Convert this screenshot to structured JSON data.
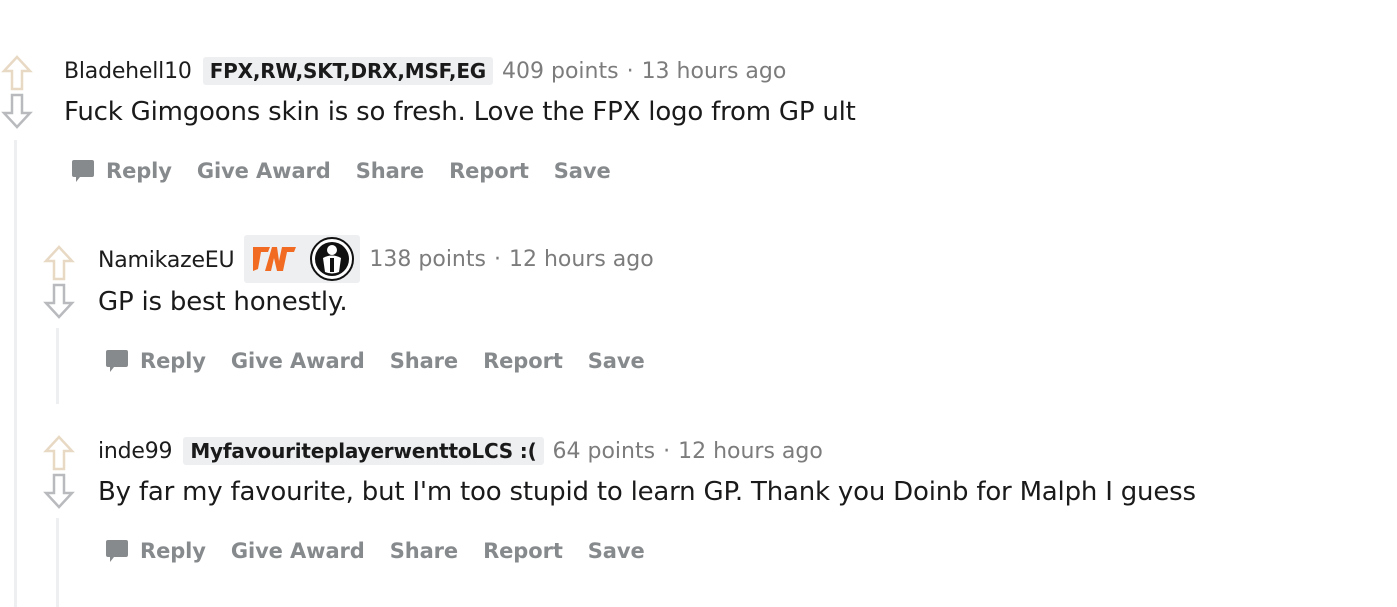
{
  "colors": {
    "upvote_arrow": "#e8d9c4",
    "downvote_arrow": "#b8babd",
    "thread_line": "#edeff1",
    "flair_bg": "#edeff1",
    "action_text": "#878a8c",
    "fnatic_orange": "#f26b22"
  },
  "actions": {
    "reply": "Reply",
    "give_award": "Give Award",
    "share": "Share",
    "report": "Report",
    "save": "Save"
  },
  "comments": [
    {
      "author": "Bladehell10",
      "flair": "FPX,RW,SKT,DRX,MSF,EG",
      "points": "409 points",
      "separator": "·",
      "time": "13 hours ago",
      "body": "Fuck Gimgoons skin is so fresh. Love the FPX logo from GP ult"
    },
    {
      "author": "NamikazeEU",
      "flair_icons": [
        "fnatic-logo-icon",
        "ig-logo-icon"
      ],
      "points": "138 points",
      "separator": "·",
      "time": "12 hours ago",
      "body": "GP is best honestly."
    },
    {
      "author": "inde99",
      "flair": "MyfavouriteplayerwenttoLCS :(",
      "points": "64 points",
      "separator": "·",
      "time": "12 hours ago",
      "body": "By far my favourite, but I'm too stupid to learn GP. Thank you Doinb for Malph I guess"
    }
  ]
}
